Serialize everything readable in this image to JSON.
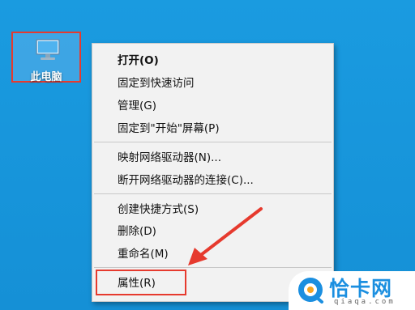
{
  "desktop": {
    "icon_label": "此电脑",
    "icon_name": "this-pc-icon"
  },
  "context_menu": {
    "items": [
      {
        "label": "打开(O)",
        "bold": true
      },
      {
        "label": "固定到快速访问"
      },
      {
        "label": "管理(G)"
      },
      {
        "label": "固定到\"开始\"屏幕(P)"
      },
      {
        "label": "映射网络驱动器(N)..."
      },
      {
        "label": "断开网络驱动器的连接(C)..."
      },
      {
        "label": "创建快捷方式(S)"
      },
      {
        "label": "删除(D)"
      },
      {
        "label": "重命名(M)"
      },
      {
        "label": "属性(R)"
      }
    ]
  },
  "annotation": {
    "highlight_color": "#e63a2e",
    "arrow_color": "#e63a2e"
  },
  "watermark": {
    "brand_text": "恰卡网",
    "url_text": "qiaqa.com",
    "brand_color": "#1b8fe0"
  }
}
